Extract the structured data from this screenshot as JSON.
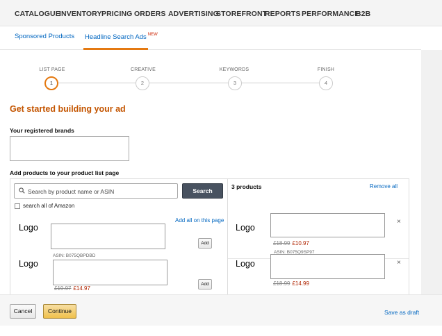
{
  "topnav": {
    "items": [
      "CATALOGUE",
      "INVENTORY",
      "PRICING",
      "ORDERS",
      "ADVERTISING",
      "STOREFRONT",
      "REPORTS",
      "PERFORMANCE",
      "B2B"
    ]
  },
  "subtabs": {
    "sponsored_products": "Sponsored Products",
    "headline_search_ads": "Headline Search Ads",
    "new_badge": "NEW"
  },
  "stepper": {
    "steps": [
      {
        "label": "LIST PAGE",
        "number": "1",
        "active": true
      },
      {
        "label": "CREATIVE",
        "number": "2",
        "active": false
      },
      {
        "label": "KEYWORDS",
        "number": "3",
        "active": false
      },
      {
        "label": "FINISH",
        "number": "4",
        "active": false
      }
    ]
  },
  "main": {
    "title": "Get started building your ad",
    "brands_label": "Your registered brands",
    "products_label": "Add products to your product list page"
  },
  "search": {
    "placeholder": "Search by product name or ASIN",
    "button": "Search",
    "checkbox_label": "search all of Amazon",
    "add_all_link": "Add all on this page"
  },
  "results": [
    {
      "logo": "Logo",
      "asin": "ASIN: B075QBPDBD",
      "add_label": "Add"
    },
    {
      "logo": "Logo",
      "old_price": "£19.97",
      "new_price": "£14.97",
      "add_label": "Add"
    }
  ],
  "selected": {
    "count_label": "3 products",
    "remove_all": "Remove all",
    "items": [
      {
        "logo": "Logo",
        "old_price": "£18.99",
        "new_price": "£10.97",
        "asin": "ASIN: B075Q9SP97",
        "remove": "×"
      },
      {
        "logo": "Logo",
        "old_price": "£18.99",
        "new_price": "£14.99",
        "remove": "×"
      }
    ]
  },
  "footer": {
    "cancel": "Cancel",
    "continue": "Continue",
    "save_draft": "Save as draft"
  },
  "colors": {
    "accent_orange": "#e47911",
    "title_orange": "#c45500",
    "link_blue": "#0066c0",
    "price_red": "#b12704",
    "search_button": "#485260",
    "continue_button": "#f0c14b"
  }
}
